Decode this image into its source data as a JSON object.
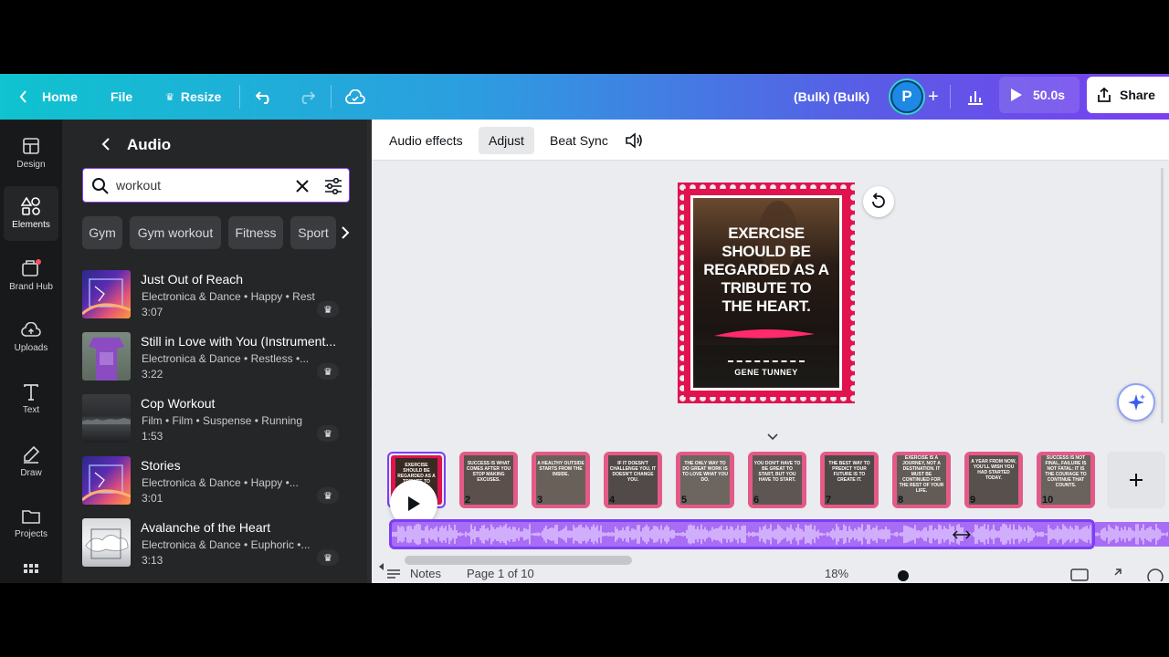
{
  "topbar": {
    "home": "Home",
    "file": "File",
    "resize": "Resize",
    "doc_title": "(Bulk) (Bulk)",
    "avatar": "P",
    "duration": "50.0s",
    "share": "Share"
  },
  "rail": {
    "items": [
      "Design",
      "Elements",
      "Brand Hub",
      "Uploads",
      "Text",
      "Draw",
      "Projects"
    ]
  },
  "panel": {
    "title": "Audio",
    "search_value": "workout",
    "chips": [
      "Gym",
      "Gym workout",
      "Fitness",
      "Sport"
    ],
    "tracks": [
      {
        "title": "Just Out of Reach",
        "meta": "Electronica & Dance • Happy • Restless",
        "duration": "3:07"
      },
      {
        "title": "Still in Love with You (Instrument...",
        "meta": "Electronica & Dance • Restless •...",
        "duration": "3:22"
      },
      {
        "title": "Cop Workout",
        "meta": "Film • Film • Suspense • Running",
        "duration": "1:53"
      },
      {
        "title": "Stories",
        "meta": "Electronica & Dance • Happy •...",
        "duration": "3:01"
      },
      {
        "title": "Avalanche of the Heart",
        "meta": "Electronica & Dance • Euphoric •...",
        "duration": "3:13"
      }
    ]
  },
  "toolbar": {
    "audio_effects": "Audio effects",
    "adjust": "Adjust",
    "beat_sync": "Beat Sync"
  },
  "design": {
    "quote": [
      "EXERCISE",
      "SHOULD BE",
      "REGARDED AS A",
      "TRIBUTE TO",
      "THE HEART."
    ],
    "author": "GENE TUNNEY"
  },
  "timeline": {
    "pages": [
      "2",
      "3",
      "4",
      "5",
      "6",
      "7",
      "8",
      "9",
      "10"
    ]
  },
  "footer": {
    "notes": "Notes",
    "page_info": "Page 1 of 10",
    "zoom": "18%"
  },
  "colors": {
    "accent": "#8b3dff",
    "stamp": "#e0134f",
    "audio": "#a86cf5"
  }
}
